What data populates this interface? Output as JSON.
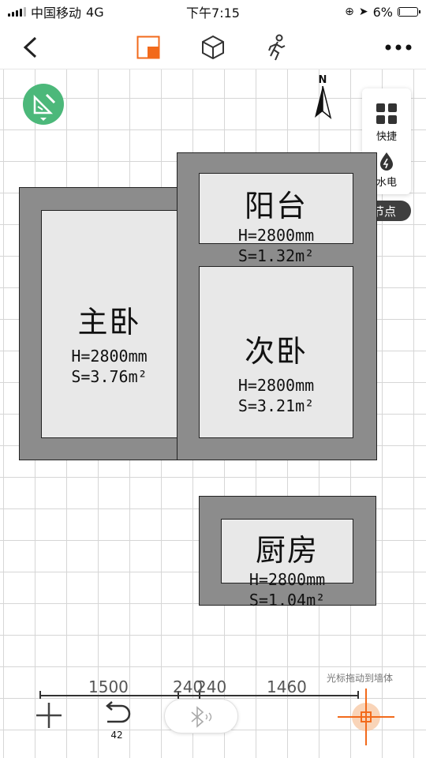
{
  "status_bar": {
    "carrier": "中国移动",
    "network": "4G",
    "time": "下午7:15",
    "battery": "6%",
    "battery_level": 0.06
  },
  "nav": {
    "back_icon": "chevron-left-icon",
    "view_2d_icon": "floorplan-2d-icon",
    "view_3d_icon": "cube-icon",
    "walk_icon": "walking-person-icon",
    "more_icon": "more-icon",
    "accent_color": "#f26a1b"
  },
  "canvas": {
    "tool_icon": "set-square-icon",
    "tool_color": "#4cb87a",
    "compass_label": "N"
  },
  "side_panel": {
    "quick_label": "快捷",
    "plumbing_label": "水电",
    "tooltip": "显示水电节点"
  },
  "rooms": [
    {
      "id": "balcony",
      "name": "阳台",
      "height": "H=2800mm",
      "area": "S=1.32m²"
    },
    {
      "id": "master",
      "name": "主卧",
      "height": "H=2800mm",
      "area": "S=3.76m²"
    },
    {
      "id": "second",
      "name": "次卧",
      "height": "H=2800mm",
      "area": "S=3.21m²"
    },
    {
      "id": "kitchen",
      "name": "厨房",
      "height": "H=2800mm",
      "area": "S=1.04m²"
    }
  ],
  "ruler": {
    "dim_1": "1500",
    "dim_2": "240",
    "dim_3": "240",
    "dim_4": "1460"
  },
  "bottom": {
    "undo_count": "42",
    "cursor_hint": "光标拖动到墙体"
  }
}
